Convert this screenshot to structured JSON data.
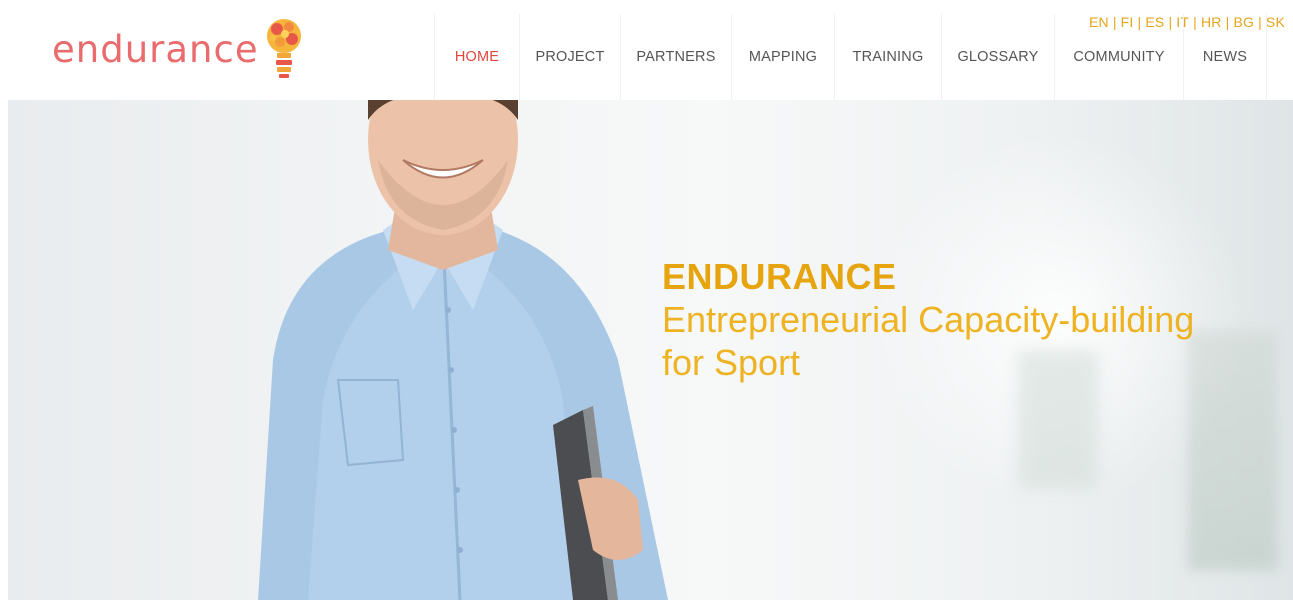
{
  "brand": {
    "logo_text": "endurance",
    "logo_icon": "lightbulb-icon"
  },
  "languages": [
    "EN",
    "FI",
    "ES",
    "IT",
    "HR",
    "BG",
    "SK"
  ],
  "nav": [
    {
      "label": "HOME",
      "active": true
    },
    {
      "label": "PROJECT",
      "active": false
    },
    {
      "label": "PARTNERS",
      "active": false
    },
    {
      "label": "MAPPING",
      "active": false
    },
    {
      "label": "TRAINING",
      "active": false
    },
    {
      "label": "GLOSSARY",
      "active": false
    },
    {
      "label": "COMMUNITY",
      "active": false
    },
    {
      "label": "NEWS",
      "active": false
    }
  ],
  "hero": {
    "title": "ENDURANCE",
    "subtitle_line1": "Entrepreneurial Capacity-building",
    "subtitle_line2": "for Sport",
    "image": "smiling-man-with-laptop"
  },
  "colors": {
    "accent_gold": "#e6a40f",
    "active_nav": "#e0453e",
    "logo": "#e96b6d"
  }
}
